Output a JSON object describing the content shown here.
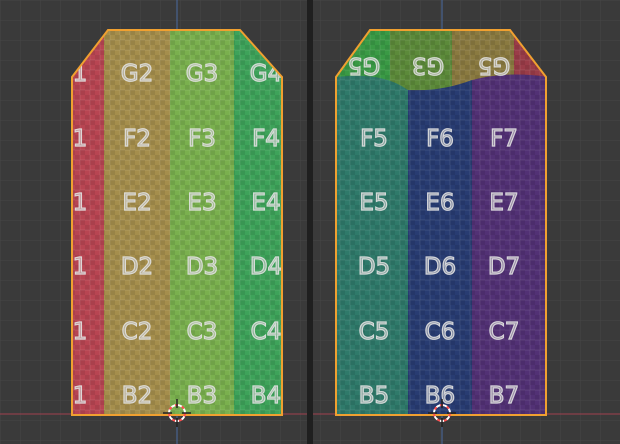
{
  "viewports": [
    {
      "id": "left",
      "name": "uv-editor-viewport-left",
      "labels": [
        [
          "1",
          "G2",
          "G3",
          "G4"
        ],
        [
          "1",
          "F2",
          "F3",
          "F4"
        ],
        [
          "1",
          "E2",
          "E3",
          "E4"
        ],
        [
          "1",
          "D2",
          "D3",
          "D4"
        ],
        [
          "1",
          "C2",
          "C3",
          "C4"
        ],
        [
          "1",
          "B2",
          "B3",
          "B4"
        ]
      ]
    },
    {
      "id": "right",
      "name": "uv-editor-viewport-right",
      "top_labels_mirrored": [
        "G5",
        "G3",
        "G5"
      ],
      "labels": [
        [
          "F5",
          "F6",
          "F7"
        ],
        [
          "E5",
          "E6",
          "E7"
        ],
        [
          "D5",
          "D6",
          "D7"
        ],
        [
          "C5",
          "C6",
          "C7"
        ],
        [
          "B5",
          "B6",
          "B7"
        ]
      ]
    }
  ],
  "colors": {
    "background": "#3a3a3a",
    "grid": "#454545",
    "axis_x": "#b0475a",
    "axis_y": "#4a6aa0",
    "selection_outline": "#f0a030",
    "panel_divider": "#1c1c1c",
    "column_red": "#b84552",
    "column_olive": "#a58e4c",
    "column_green": "#7ab04e",
    "column_emerald": "#3ea35a",
    "column_teal": "#2f7a6a",
    "column_navy": "#283c72",
    "column_purple": "#523175"
  },
  "icons": [
    "2d-cursor-icon"
  ]
}
